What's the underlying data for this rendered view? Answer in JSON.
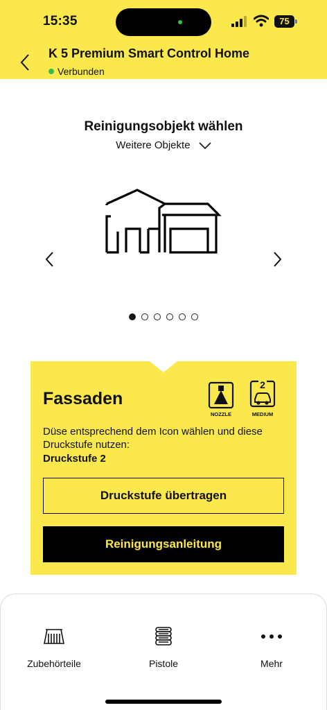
{
  "status_bar": {
    "time": "15:35",
    "battery": "75"
  },
  "header": {
    "title": "K 5 Premium Smart Control Home",
    "connection_status": "Verbunden",
    "connection_color": "#3dbb47",
    "back_icon": "chevron-left-icon"
  },
  "selector": {
    "heading": "Reinigungsobjekt wählen",
    "more_label": "Weitere Objekte",
    "current_object_icon": "house-garage-icon",
    "page_count": 6,
    "current_page": 1
  },
  "card": {
    "object_name": "Fassaden",
    "nozzle_label": "NOZZLE",
    "pressure_level_badge": "2",
    "pressure_level_label": "MEDIUM",
    "description": "Düse entsprechend dem Icon wählen und diese Druckstufe nutzen:",
    "level_text": "Druckstufe  2",
    "transfer_button": "Druckstufe übertragen",
    "guide_button": "Reinigungsanleitung"
  },
  "tabbar": {
    "items": [
      {
        "label": "Zubehörteile",
        "icon": "brush-attachment-icon"
      },
      {
        "label": "Pistole",
        "icon": "spray-gun-grip-icon"
      },
      {
        "label": "Mehr",
        "icon": "more-dots-icon"
      }
    ]
  },
  "colors": {
    "brand_yellow": "#fbe84d",
    "black": "#000000"
  }
}
